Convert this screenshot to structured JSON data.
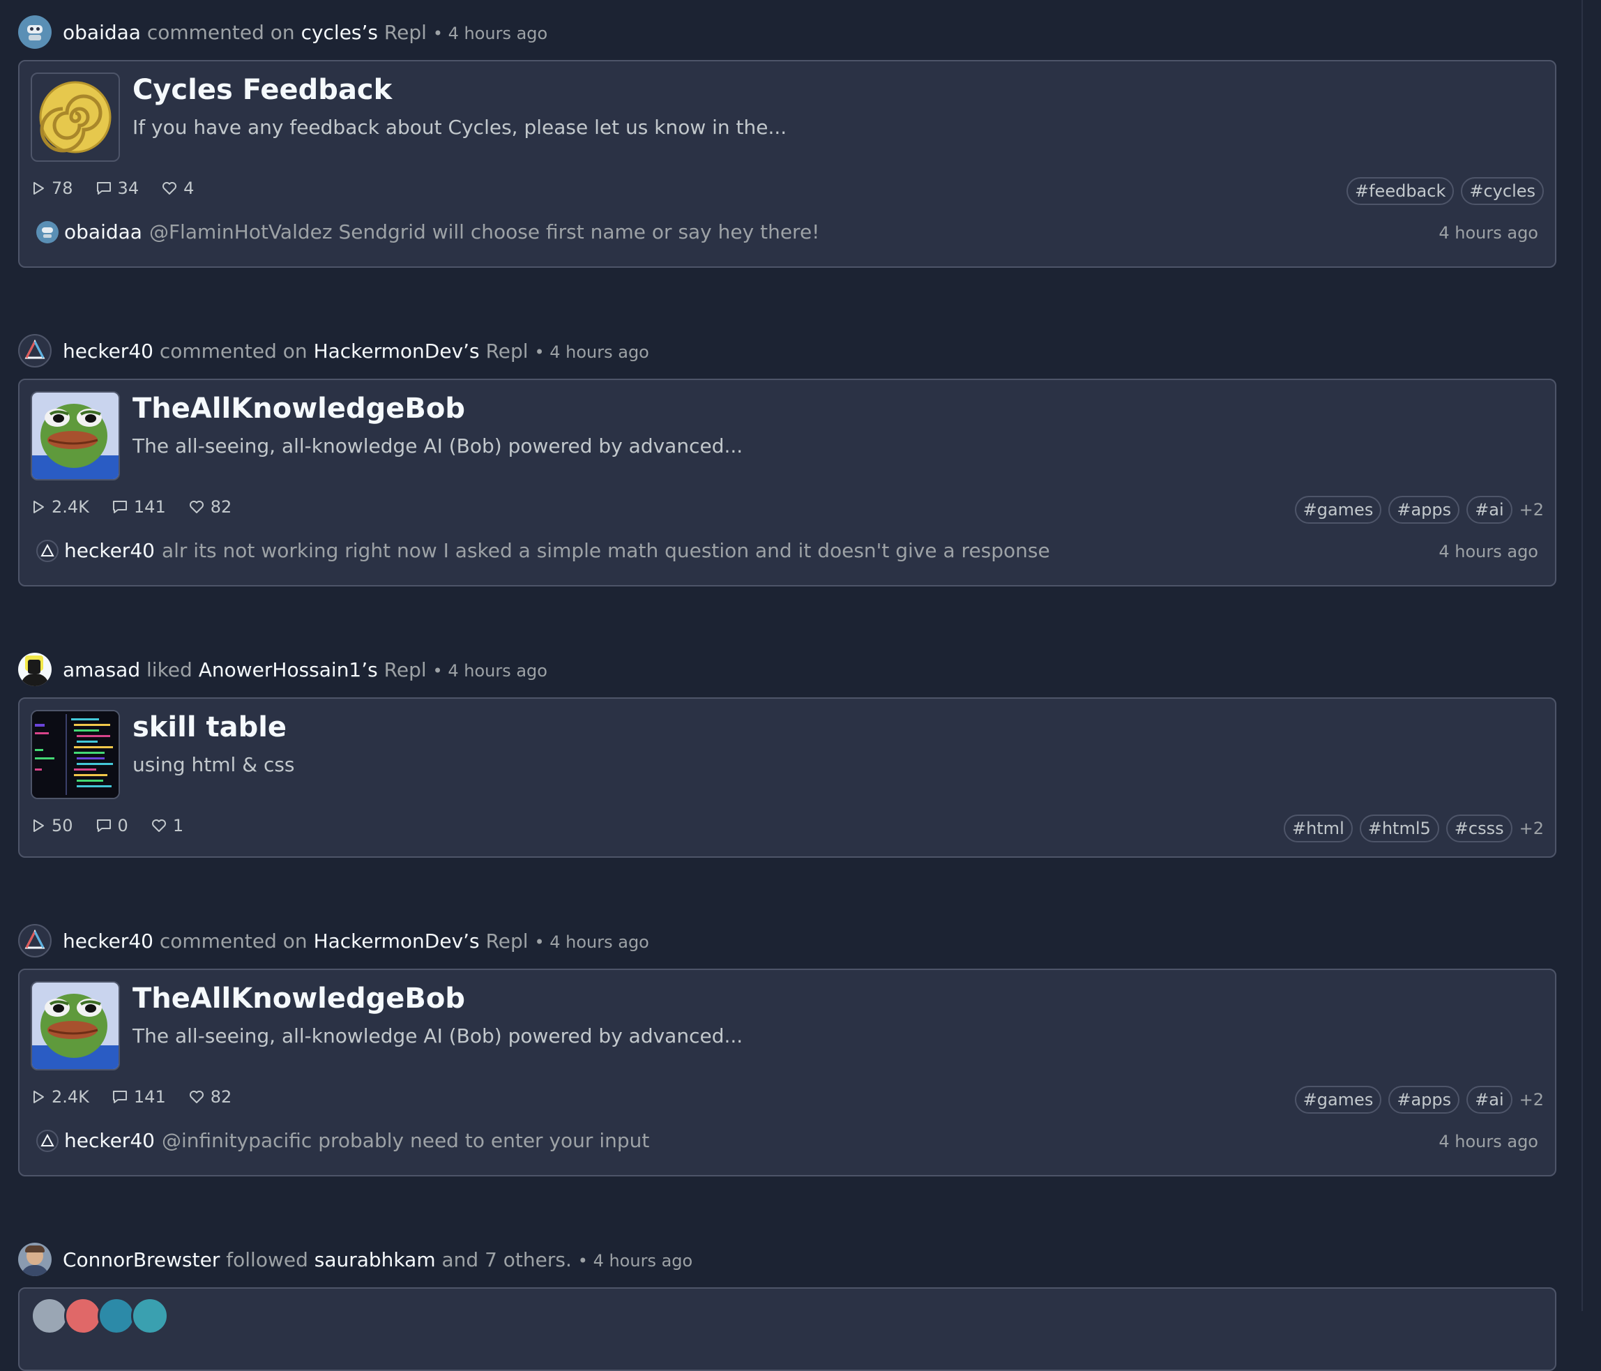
{
  "feed": [
    {
      "actor": "obaidaa",
      "verb": "commented on",
      "target": "cycles’s",
      "object": "Repl",
      "time": "• 4 hours ago",
      "repl": {
        "title": "Cycles Feedback",
        "description": "If you have any feedback about Cycles, please let us know in the...",
        "runs": "78",
        "comments": "34",
        "likes": "4",
        "tags": [
          "#feedback",
          "#cycles"
        ],
        "more": ""
      },
      "comment": {
        "author": "obaidaa",
        "text": "@FlaminHotValdez Sendgrid will choose first name or say hey there!",
        "time": "4 hours ago"
      }
    },
    {
      "actor": "hecker40",
      "verb": "commented on",
      "target": "HackermonDev’s",
      "object": "Repl",
      "time": "• 4 hours ago",
      "repl": {
        "title": "TheAllKnowledgeBob",
        "description": "The all-seeing, all-knowledge AI (Bob) powered by advanced...",
        "runs": "2.4K",
        "comments": "141",
        "likes": "82",
        "tags": [
          "#games",
          "#apps",
          "#ai"
        ],
        "more": "+2"
      },
      "comment": {
        "author": "hecker40",
        "text": "alr its not working right now I asked a simple math question and it doesn't give a response",
        "time": "4 hours ago"
      }
    },
    {
      "actor": "amasad",
      "verb": "liked",
      "target": "AnowerHossain1’s",
      "object": "Repl",
      "time": "• 4 hours ago",
      "repl": {
        "title": "skill table",
        "description": "using html & css",
        "runs": "50",
        "comments": "0",
        "likes": "1",
        "tags": [
          "#html",
          "#html5",
          "#csss"
        ],
        "more": "+2"
      }
    },
    {
      "actor": "hecker40",
      "verb": "commented on",
      "target": "HackermonDev’s",
      "object": "Repl",
      "time": "• 4 hours ago",
      "repl": {
        "title": "TheAllKnowledgeBob",
        "description": "The all-seeing, all-knowledge AI (Bob) powered by advanced...",
        "runs": "2.4K",
        "comments": "141",
        "likes": "82",
        "tags": [
          "#games",
          "#apps",
          "#ai"
        ],
        "more": "+2"
      },
      "comment": {
        "author": "hecker40",
        "text": "@infinitypacific probably need to enter your input",
        "time": "4 hours ago"
      }
    },
    {
      "actor": "ConnorBrewster",
      "verb": "followed",
      "target": "saurabhkam",
      "object": "and 7 others.",
      "time": "• 4 hours ago"
    }
  ],
  "colors": {
    "background": "#1c2333",
    "card": "#2b3245",
    "border": "#4e5569",
    "text_primary": "#f5f9fc",
    "text_secondary": "#9da2a6"
  },
  "icons": {
    "runs": "play-icon",
    "comments": "comment-icon",
    "likes": "heart-icon"
  }
}
